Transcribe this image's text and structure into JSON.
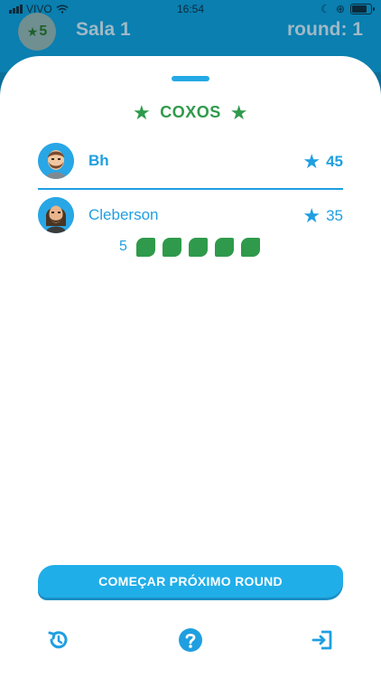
{
  "status": {
    "carrier": "VIVO",
    "time": "16:54"
  },
  "header": {
    "stars": "5",
    "room_name": "Sala 1",
    "round": "round: 1"
  },
  "team": {
    "name": "COXOS"
  },
  "players": [
    {
      "name": "Bh",
      "score": "45",
      "current": true
    },
    {
      "name": "Cleberson",
      "score": "35",
      "current": false
    }
  ],
  "pieces": {
    "count": "5",
    "total": 5
  },
  "actions": {
    "start_next_round": "COMEÇAR PRÓXIMO ROUND"
  },
  "icons": {
    "history": "history-icon",
    "help": "help-icon",
    "exit": "exit-icon"
  },
  "colors": {
    "accent": "#20aee9",
    "green": "#2f9a4b",
    "header": "#0a7fb0"
  }
}
